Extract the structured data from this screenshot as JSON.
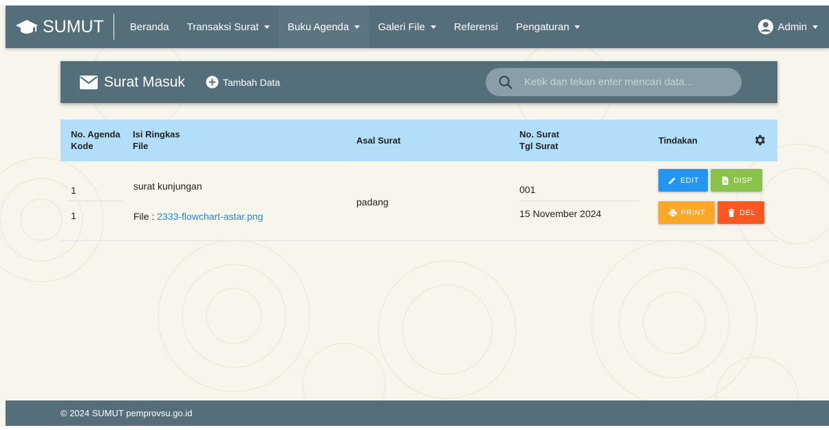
{
  "brand": {
    "name": "SUMUT",
    "logo_icon": "graduation-cap-icon"
  },
  "nav": {
    "items": [
      {
        "label": "Beranda",
        "dropdown": false,
        "active": false
      },
      {
        "label": "Transaksi Surat",
        "dropdown": true,
        "active": false
      },
      {
        "label": "Buku Agenda",
        "dropdown": true,
        "active": true
      },
      {
        "label": "Galeri File",
        "dropdown": true,
        "active": false
      },
      {
        "label": "Referensi",
        "dropdown": false,
        "active": false
      },
      {
        "label": "Pengaturan",
        "dropdown": true,
        "active": false
      }
    ],
    "user": {
      "label": "Admin",
      "icon": "account-circle-icon"
    }
  },
  "header": {
    "title": "Surat Masuk",
    "title_icon": "mail-icon",
    "add_label": "Tambah Data",
    "search_placeholder": "Ketik dan tekan enter mencari data..."
  },
  "table": {
    "columns": {
      "col1_line1": "No. Agenda",
      "col1_line2": "Kode",
      "col2_line1": "Isi Ringkas",
      "col2_line2": "File",
      "col3": "Asal Surat",
      "col4_line1": "No. Surat",
      "col4_line2": "Tgl Surat",
      "col5": "Tindakan"
    },
    "rows": [
      {
        "no_agenda": "1",
        "kode": "1",
        "isi_ringkas": "surat kunjungan",
        "file_label": "File :",
        "file_name": "2333-flowchart-astar.png",
        "asal_surat": "padang",
        "no_surat": "001",
        "tgl_surat": "15 November 2024",
        "actions": {
          "edit": "EDIT",
          "disp": "DISP",
          "print": "PRINT",
          "del": "DEL"
        }
      }
    ]
  },
  "colors": {
    "primary": "#546e7a",
    "table_header": "#b3defa",
    "edit": "#2196f3",
    "disp": "#8bc34a",
    "print": "#ffa726",
    "del": "#ff5722",
    "link": "#1e88e5"
  },
  "footer": {
    "text": "© 2024 SUMUT pemprovsu.go.id"
  }
}
